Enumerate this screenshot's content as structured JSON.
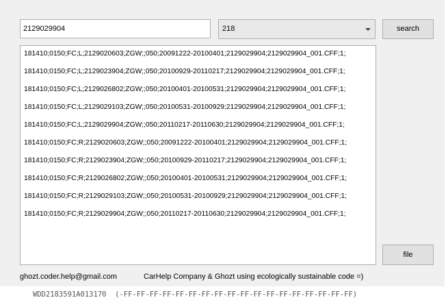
{
  "search_input": {
    "value": "2129029904"
  },
  "combo": {
    "selected": "218"
  },
  "buttons": {
    "search_label": "search",
    "file_label": "file"
  },
  "results": [
    "181410;0150;FC;L;2129020603;ZGW;;050;20091222-20100401;2129029904;2129029904_001.CFF;1;",
    "181410;0150;FC;L;2129023904;ZGW;;050;20100929-20110217;2129029904;2129029904_001.CFF;1;",
    "181410;0150;FC;L;2129026802;ZGW;;050;20100401-20100531;2129029904;2129029904_001.CFF;1;",
    "181410;0150;FC;L;2129029103;ZGW;;050;20100531-20100929;2129029904;2129029904_001.CFF;1;",
    "181410;0150;FC;L;2129029904;ZGW;;050;20110217-20110630;2129029904;2129029904_001.CFF;1;",
    "181410;0150;FC;R;2129020603;ZGW;;050;20091222-20100401;2129029904;2129029904_001.CFF;1;",
    "181410;0150;FC;R;2129023904;ZGW;;050;20100929-20110217;2129029904;2129029904_001.CFF;1;",
    "181410;0150;FC;R;2129026802;ZGW;;050;20100401-20100531;2129029904;2129029904_001.CFF;1;",
    "181410;0150;FC;R;2129029103;ZGW;;050;20100531-20100929;2129029904;2129029904_001.CFF;1;",
    "181410;0150;FC;R;2129029904;ZGW;;050;20110217-20110630;2129029904;2129029904_001.CFF;1;"
  ],
  "footer": {
    "email": "ghozt.coder.help@gmail.com",
    "credit": "CarHelp Company & Ghozt using ecologically sustainable code =)"
  },
  "background_text": "WDD2183591A013170  (-FF-FF-FF-FF-FF-FF-FF-FF-FF-FF-FF-FF-FF-FF-FF-FF-FF-FF)"
}
